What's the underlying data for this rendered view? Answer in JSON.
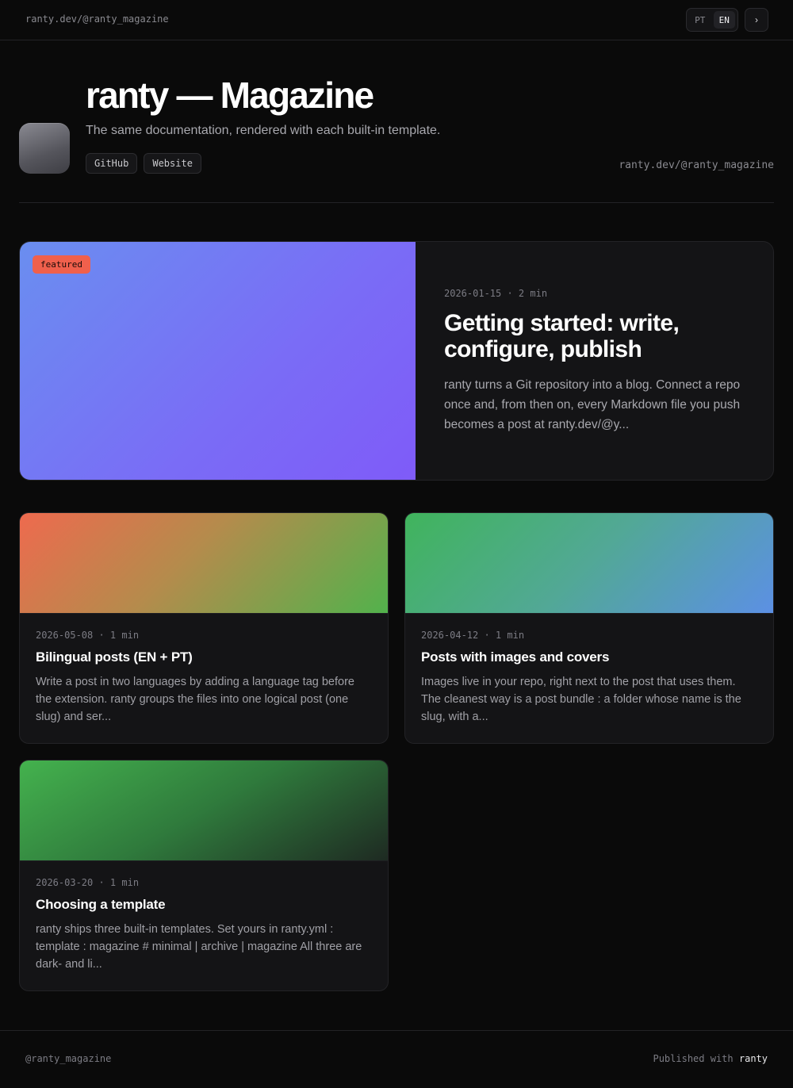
{
  "topbar": {
    "brand": "ranty.dev/@ranty_magazine",
    "languages": [
      "PT",
      "EN"
    ],
    "active_language": "EN",
    "theme_toggle_glyph": "›"
  },
  "header": {
    "title": "ranty — Magazine",
    "subtitle": "The same documentation, rendered with each built-in template.",
    "links": [
      "GitHub",
      "Website"
    ],
    "handle": "ranty.dev/@ranty_magazine"
  },
  "featured": {
    "badge": "featured",
    "meta": "2026-01-15 · 2 min",
    "title": "Getting started: write, configure, publish",
    "excerpt": "ranty turns a Git repository into a blog. Connect a repo once and, from then on, every Markdown file you push becomes a post at ranty.dev/@y..."
  },
  "posts": [
    {
      "meta": "2026-05-08 · 1 min",
      "title": "Bilingual posts (EN + PT)",
      "excerpt": "Write a post in two languages by adding a language tag before the extension. ranty groups the files into one logical post (one slug) and ser..."
    },
    {
      "meta": "2026-04-12 · 1 min",
      "title": "Posts with images and covers",
      "excerpt": "Images live in your repo, right next to the post that uses them. The cleanest way is a post bundle : a folder whose name is the slug, with a..."
    },
    {
      "meta": "2026-03-20 · 1 min",
      "title": "Choosing a template",
      "excerpt": "ranty ships three built-in templates. Set yours in ranty.yml : template : magazine # minimal | archive | magazine All three are dark- and li..."
    }
  ],
  "footer": {
    "handle": "@ranty_magazine",
    "published_prefix": "Published with",
    "published_brand": "ranty"
  },
  "colors": {
    "background": "#0a0a0a",
    "card": "#141416",
    "featured_badge": "#f0604c"
  }
}
